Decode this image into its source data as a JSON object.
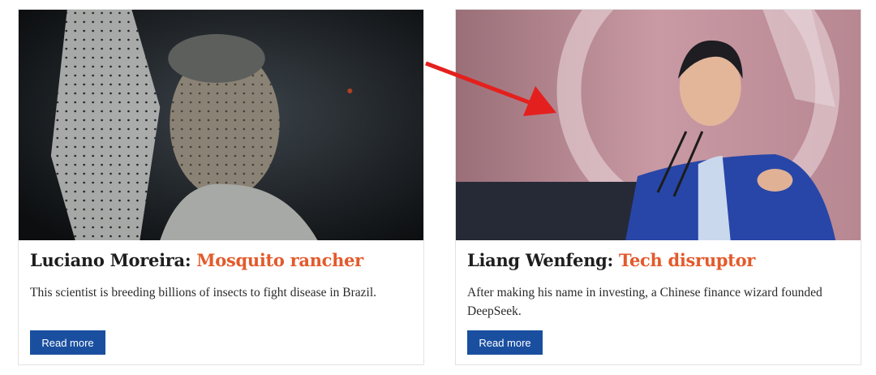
{
  "cards": [
    {
      "name": "Luciano Moreira:",
      "role": "Mosquito rancher",
      "description": "This scientist is breeding billions of insects to fight disease in Brazil.",
      "button_label": "Read more"
    },
    {
      "name": "Liang Wenfeng:",
      "role": "Tech disruptor",
      "description": "After making his name in investing, a Chinese finance wizard founded DeepSeek.",
      "button_label": "Read more"
    }
  ],
  "colors": {
    "accent": "#e35a2b",
    "button": "#1a4fa0",
    "annotation_arrow": "#e4201e"
  }
}
